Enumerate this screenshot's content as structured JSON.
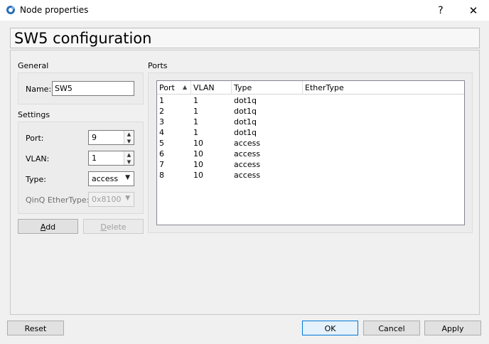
{
  "window": {
    "title": "Node properties",
    "help_glyph": "?",
    "close_glyph": "✕"
  },
  "header": {
    "title": "SW5 configuration"
  },
  "general": {
    "label": "General",
    "name_label": "Name:",
    "name_value": "SW5"
  },
  "settings": {
    "label": "Settings",
    "port_label": "Port:",
    "port_value": "9",
    "vlan_label": "VLAN:",
    "vlan_value": "1",
    "type_label": "Type:",
    "type_value": "access",
    "qinq_label": "QinQ EtherType:",
    "qinq_value": "0x8100"
  },
  "buttons": {
    "add": "Add",
    "delete": "Delete",
    "reset": "Reset",
    "ok": "OK",
    "cancel": "Cancel",
    "apply": "Apply"
  },
  "ports": {
    "label": "Ports",
    "columns": [
      "Port",
      "VLAN",
      "Type",
      "EtherType"
    ],
    "sort_column": "Port",
    "rows": [
      [
        "1",
        "1",
        "dot1q",
        ""
      ],
      [
        "2",
        "1",
        "dot1q",
        ""
      ],
      [
        "3",
        "1",
        "dot1q",
        ""
      ],
      [
        "4",
        "1",
        "dot1q",
        ""
      ],
      [
        "5",
        "10",
        "access",
        ""
      ],
      [
        "6",
        "10",
        "access",
        ""
      ],
      [
        "7",
        "10",
        "access",
        ""
      ],
      [
        "8",
        "10",
        "access",
        ""
      ]
    ]
  },
  "icons": {
    "app": "app-logo-icon",
    "help": "help-icon",
    "close": "close-icon",
    "sort": "sort-ascending-icon",
    "spin_up": "spin-up-icon",
    "spin_down": "spin-down-icon",
    "dropdown": "dropdown-arrow-icon"
  },
  "colors": {
    "accent": "#0078d7",
    "window_bg": "#f0f0f0",
    "titlebar_bg": "#ffffff"
  }
}
